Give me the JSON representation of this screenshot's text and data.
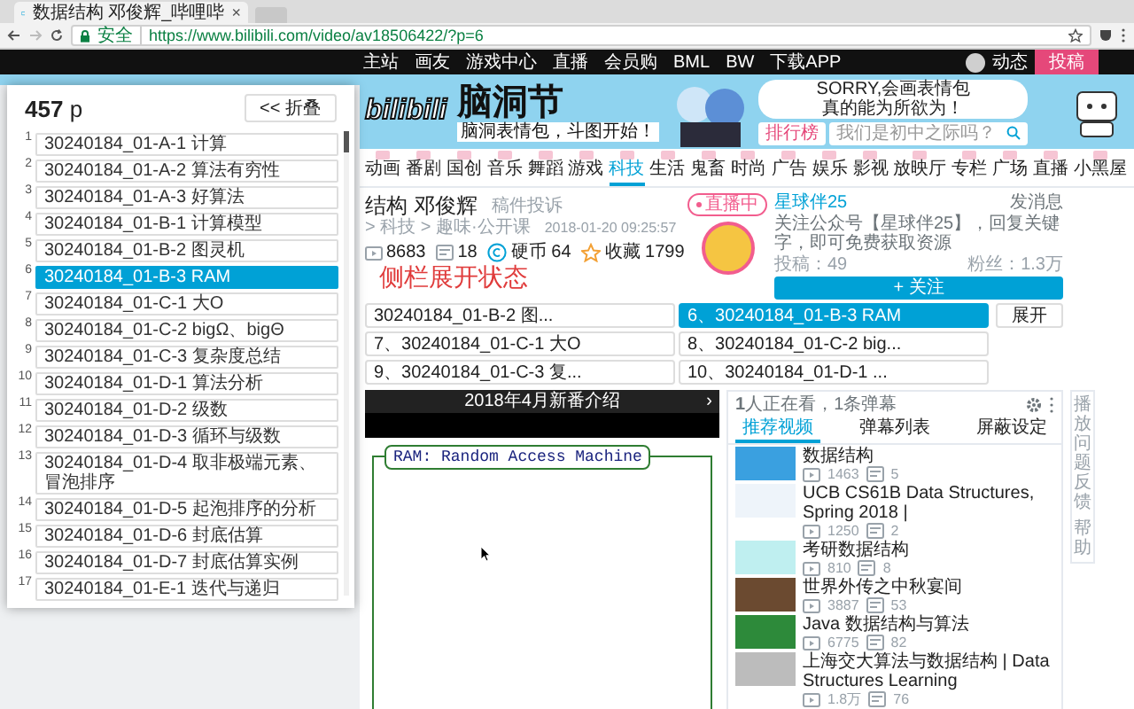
{
  "browser": {
    "tab_title": "数据结构 邓俊辉_哔哩哔",
    "tab_close": "×",
    "security": "安全",
    "url": "https://www.bilibili.com/video/av18506422/?p=6"
  },
  "site_header": {
    "links": [
      "主站",
      "画友",
      "游戏中心",
      "直播",
      "会员购",
      "BML",
      "BW",
      "下载APP"
    ],
    "user_link": "动态",
    "upload_button": "投稿"
  },
  "banner": {
    "logo": "bilibili",
    "event_title": "脑洞节",
    "event_subtitle": "脑洞表情包，斗图开始！",
    "bubble_lines": [
      "SORRY,会画表情包",
      "真的能为所欲为！"
    ],
    "ranking_button": "排行榜",
    "search_placeholder": "我们是初中之际吗？"
  },
  "categories": [
    {
      "label": "动画",
      "selected": false
    },
    {
      "label": "番剧",
      "selected": false
    },
    {
      "label": "国创",
      "selected": false
    },
    {
      "label": "音乐",
      "selected": false
    },
    {
      "label": "舞蹈",
      "selected": false
    },
    {
      "label": "游戏",
      "selected": false
    },
    {
      "label": "科技",
      "selected": true
    },
    {
      "label": "生活",
      "selected": false
    },
    {
      "label": "鬼畜",
      "selected": false
    },
    {
      "label": "时尚",
      "selected": false
    },
    {
      "label": "广告",
      "selected": false
    },
    {
      "label": "娱乐",
      "selected": false
    },
    {
      "label": "影视",
      "selected": false
    },
    {
      "label": "放映厅",
      "selected": false
    },
    {
      "label": "专栏",
      "selected": false
    },
    {
      "label": "广场",
      "selected": false
    },
    {
      "label": "直播",
      "selected": false
    },
    {
      "label": "小黑屋",
      "selected": false
    }
  ],
  "parts_panel": {
    "count": "457",
    "unit": "p",
    "collapse_button": "<< 折叠",
    "items": [
      {
        "number": "1",
        "title": "30240184_01-A-1 计算",
        "selected": false
      },
      {
        "number": "2",
        "title": "30240184_01-A-2 算法有穷性",
        "selected": false
      },
      {
        "number": "3",
        "title": "30240184_01-A-3 好算法",
        "selected": false
      },
      {
        "number": "4",
        "title": "30240184_01-B-1 计算模型",
        "selected": false
      },
      {
        "number": "5",
        "title": "30240184_01-B-2 图灵机",
        "selected": false
      },
      {
        "number": "6",
        "title": "30240184_01-B-3 RAM",
        "selected": true
      },
      {
        "number": "7",
        "title": "30240184_01-C-1 大O",
        "selected": false
      },
      {
        "number": "8",
        "title": "30240184_01-C-2 bigΩ、bigΘ",
        "selected": false
      },
      {
        "number": "9",
        "title": "30240184_01-C-3 复杂度总结",
        "selected": false
      },
      {
        "number": "10",
        "title": "30240184_01-D-1 算法分析",
        "selected": false
      },
      {
        "number": "11",
        "title": "30240184_01-D-2 级数",
        "selected": false
      },
      {
        "number": "12",
        "title": "30240184_01-D-3 循环与级数",
        "selected": false
      },
      {
        "number": "13",
        "title": "30240184_01-D-4 取非极端元素、冒泡排序",
        "selected": false
      },
      {
        "number": "14",
        "title": "30240184_01-D-5 起泡排序的分析",
        "selected": false
      },
      {
        "number": "15",
        "title": "30240184_01-D-6 封底估算",
        "selected": false
      },
      {
        "number": "16",
        "title": "30240184_01-D-7 封底估算实例",
        "selected": false
      },
      {
        "number": "17",
        "title": "30240184_01-E-1 迭代与递归",
        "selected": false
      }
    ]
  },
  "video": {
    "title": "结构 邓俊辉",
    "breadcrumb": "> 科技 > 趣味·公开课",
    "date": "2018-01-20 09:25:57",
    "report": "稿件投诉",
    "stats": [
      {
        "kind": "play",
        "value": "8683"
      },
      {
        "kind": "danmaku",
        "value": "18"
      },
      {
        "kind": "coin",
        "value": "硬币 64"
      },
      {
        "kind": "favorite",
        "value": "收藏 1799"
      }
    ],
    "annotation": "侧栏展开状态"
  },
  "uploader": {
    "status": "直播中",
    "name": "星球伴25",
    "message_button": "发消息",
    "description": "关注公众号【星球伴25】，回复关键字，即可免费获取资源",
    "posts": "投稿：49",
    "fans": "粉丝：1.3万",
    "follow_button": "+ 关注"
  },
  "part_tabs": [
    {
      "label": "30240184_01-B-2 图...",
      "selected": false
    },
    {
      "label": "6、30240184_01-B-3 RAM",
      "selected": true
    },
    {
      "label": "7、30240184_01-C-1 大O",
      "selected": false
    },
    {
      "label": "8、30240184_01-C-2 big...",
      "selected": false
    },
    {
      "label": "9、30240184_01-C-3 复...",
      "selected": false
    },
    {
      "label": "10、30240184_01-D-1 ...",
      "selected": false
    }
  ],
  "expand_button": "展开",
  "player": {
    "title": "2018年4月新番介绍",
    "next": "›",
    "slide_heading": "RAM: Random Access Machine"
  },
  "danmaku": {
    "viewers": "**1**人正在看，1条弹幕",
    "tabs": [
      {
        "label": "推荐视频",
        "selected": true
      },
      {
        "label": "弹幕列表",
        "selected": false
      },
      {
        "label": "屏蔽设定",
        "selected": false
      }
    ],
    "recommendations": [
      {
        "title": "数据结构",
        "plays": "1463",
        "danmaku": "5"
      },
      {
        "title": "UCB CS61B Data Structures, Spring 2018 |",
        "plays": "1250",
        "danmaku": "2"
      },
      {
        "title": "考研数据结构",
        "plays": "810",
        "danmaku": "8"
      },
      {
        "title": "世界外传之中秋宴间",
        "plays": "3887",
        "danmaku": "53"
      },
      {
        "title": "Java 数据结构与算法",
        "plays": "6775",
        "danmaku": "82"
      },
      {
        "title": "上海交大算法与数据结构 | Data Structures Learning",
        "plays": "1.8万",
        "danmaku": "76"
      }
    ]
  },
  "side_tabs": [
    "播放问题反馈",
    "帮助"
  ]
}
